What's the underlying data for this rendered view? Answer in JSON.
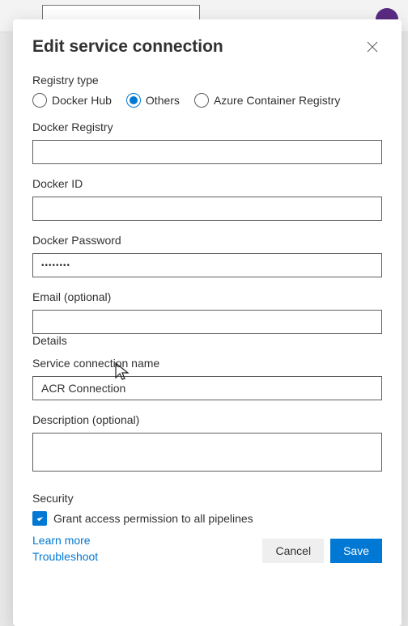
{
  "panel": {
    "title": "Edit service connection"
  },
  "registry_type": {
    "label": "Registry type",
    "options": [
      {
        "label": "Docker Hub",
        "selected": false
      },
      {
        "label": "Others",
        "selected": true
      },
      {
        "label": "Azure Container Registry",
        "selected": false
      }
    ]
  },
  "fields": {
    "docker_registry": {
      "label": "Docker Registry",
      "value": ""
    },
    "docker_id": {
      "label": "Docker ID",
      "value": ""
    },
    "docker_password": {
      "label": "Docker Password",
      "value": "••••••••"
    },
    "email": {
      "label": "Email (optional)",
      "value": ""
    },
    "service_connection_name": {
      "label": "Service connection name",
      "value": "ACR Connection"
    },
    "description": {
      "label": "Description (optional)",
      "value": ""
    }
  },
  "sections": {
    "details": "Details",
    "security": "Security"
  },
  "security": {
    "grant_access_label": "Grant access permission to all pipelines",
    "grant_access_checked": true
  },
  "footer": {
    "learn_more": "Learn more",
    "troubleshoot": "Troubleshoot",
    "cancel": "Cancel",
    "save": "Save"
  }
}
